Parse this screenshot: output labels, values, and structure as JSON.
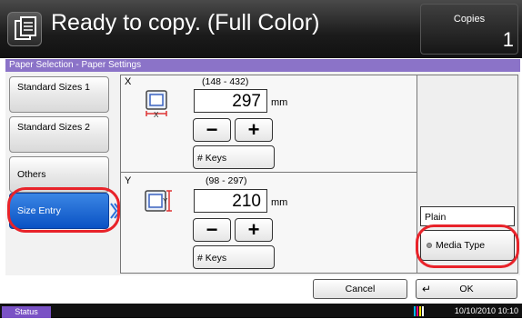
{
  "header": {
    "title": "Ready to copy. (Full Color)",
    "copies_label": "Copies",
    "copies_value": "1"
  },
  "dialog": {
    "title": "Paper Selection - Paper Settings"
  },
  "sidebar": {
    "items": [
      {
        "label": "Standard Sizes 1"
      },
      {
        "label": "Standard Sizes 2"
      },
      {
        "label": "Others"
      },
      {
        "label": "Size Entry",
        "selected": true
      }
    ]
  },
  "x_section": {
    "axis": "X",
    "range": "(148 - 432)",
    "value": "297",
    "unit": "mm",
    "minus": "−",
    "plus": "+",
    "keys_label": "# Keys"
  },
  "y_section": {
    "axis": "Y",
    "range": "(98 - 297)",
    "value": "210",
    "unit": "mm",
    "minus": "−",
    "plus": "+",
    "keys_label": "# Keys"
  },
  "media": {
    "current_type": "Plain",
    "button_label": "Media Type"
  },
  "footer": {
    "cancel_label": "Cancel",
    "ok_label": "OK"
  },
  "status_bar": {
    "status_label": "Status",
    "datetime": "10/10/2010  10:10"
  },
  "colors": {
    "accent_purple": "#8b73c8",
    "selected_blue": "#0a52c4",
    "highlight_red": "#e8232a"
  }
}
